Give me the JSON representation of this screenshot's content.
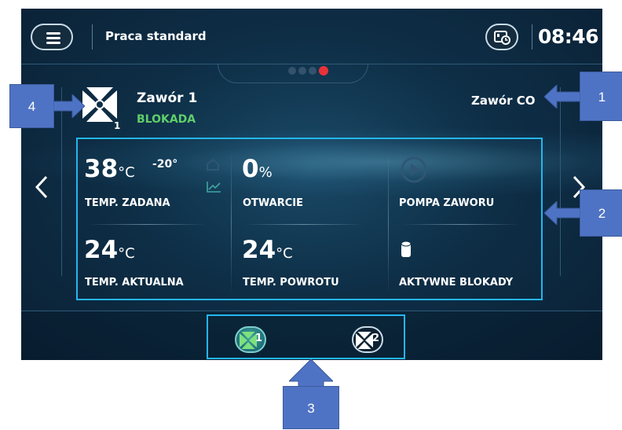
{
  "header": {
    "title": "Praca standard",
    "clock": "08:46"
  },
  "pager": {
    "pages": 4,
    "active_index": 3
  },
  "valve": {
    "name": "Zawór 1",
    "number": "1",
    "status": "BLOKADA",
    "type": "Zawór CO"
  },
  "tiles": {
    "temp_zadana": {
      "value": "38",
      "unit": "°C",
      "offset": "-20°",
      "label": "TEMP. ZADANA"
    },
    "otwarcie": {
      "value": "0",
      "unit": "%",
      "label": "OTWARCIE"
    },
    "pompa": {
      "label": "POMPA ZAWORU"
    },
    "temp_aktualna": {
      "value": "24",
      "unit": "°C",
      "label": "TEMP. AKTUALNA"
    },
    "temp_powrotu": {
      "value": "24",
      "unit": "°C",
      "label": "TEMP. POWROTU"
    },
    "blokady": {
      "label": "AKTYWNE BLOKADY"
    }
  },
  "valve_buttons": [
    {
      "number": "1"
    },
    {
      "number": "2"
    }
  ],
  "callouts": {
    "c1": "1",
    "c2": "2",
    "c3": "3",
    "c4": "4"
  },
  "colors": {
    "status_green": "#5fcf6a",
    "active_dot": "#e8323a",
    "callout_blue": "#4f73c4",
    "highlight_cyan": "#24b6f0"
  },
  "icons": [
    "menu-icon",
    "mode-icon",
    "valve-icon",
    "home-icon",
    "chart-icon",
    "play-icon",
    "lock-cylinder-icon",
    "chevron-left-icon",
    "chevron-right-icon"
  ]
}
